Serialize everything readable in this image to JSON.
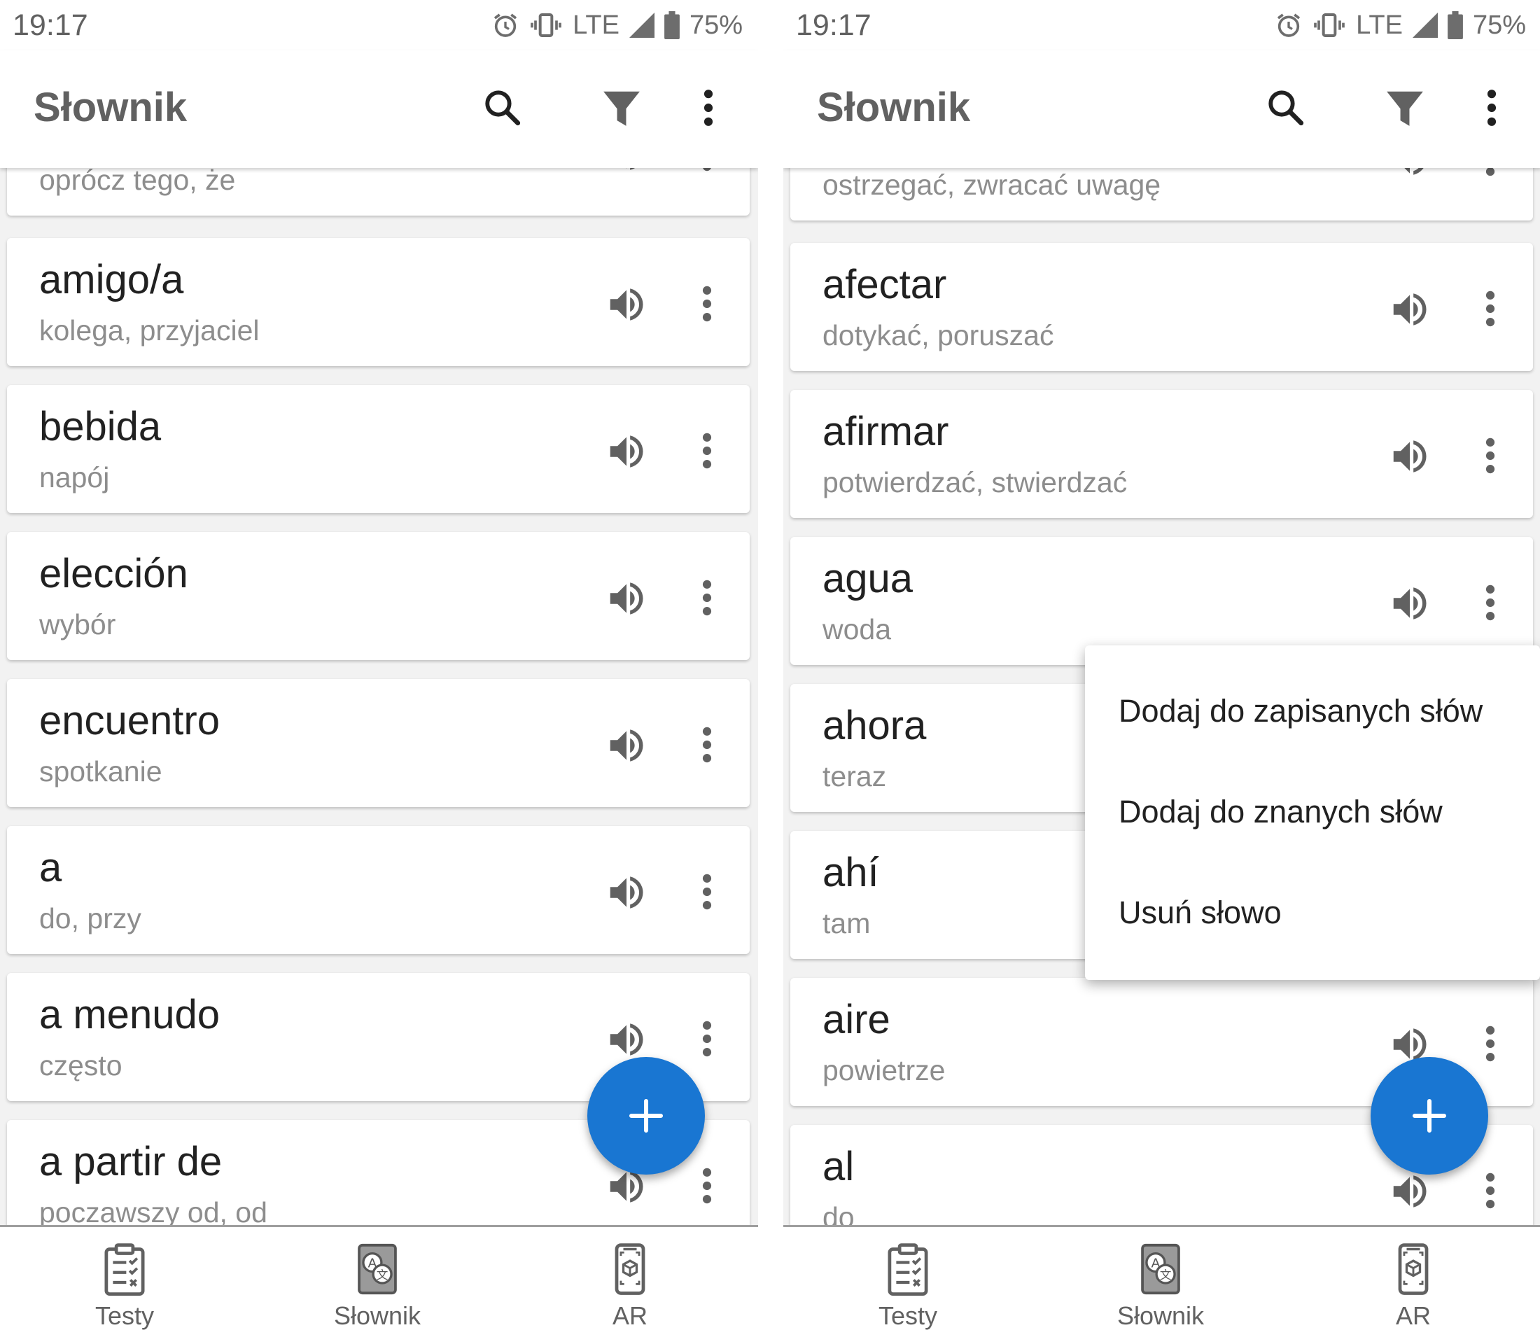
{
  "status": {
    "time": "19:17",
    "network": "LTE",
    "battery": "75%"
  },
  "appbar": {
    "title": "Słownik",
    "search_icon": "search-icon",
    "filter_icon": "filter-icon",
    "more_icon": "more-vert-icon"
  },
  "left_list": [
    {
      "word": "",
      "translation": "oprócz tego, że"
    },
    {
      "word": "amigo/a",
      "translation": "kolega, przyjaciel"
    },
    {
      "word": "bebida",
      "translation": "napój"
    },
    {
      "word": "elección",
      "translation": "wybór"
    },
    {
      "word": "encuentro",
      "translation": "spotkanie"
    },
    {
      "word": "a",
      "translation": "do, przy"
    },
    {
      "word": "a menudo",
      "translation": "często"
    },
    {
      "word": "a partir de",
      "translation": "poczawszy od, od"
    }
  ],
  "right_list": [
    {
      "word": "",
      "translation": "ostrzegać, zwracać uwagę"
    },
    {
      "word": "afectar",
      "translation": "dotykać, poruszać"
    },
    {
      "word": "afirmar",
      "translation": "potwierdzać, stwierdzać"
    },
    {
      "word": "agua",
      "translation": "woda"
    },
    {
      "word": "ahora",
      "translation": "teraz"
    },
    {
      "word": "ahí",
      "translation": "tam"
    },
    {
      "word": "aire",
      "translation": "powietrze"
    },
    {
      "word": "al",
      "translation": "do"
    }
  ],
  "context_menu": {
    "items": [
      "Dodaj do zapisanych słów",
      "Dodaj do znanych słów",
      "Usuń słowo"
    ]
  },
  "bottom_nav": [
    {
      "label": "Testy",
      "icon": "clipboard-test-icon"
    },
    {
      "label": "Słownik",
      "icon": "dictionary-book-icon"
    },
    {
      "label": "AR",
      "icon": "ar-phone-icon"
    }
  ],
  "colors": {
    "fab": "#1976d2",
    "text_primary": "#212121",
    "text_secondary": "#8d8d8d",
    "icon": "#616161"
  }
}
